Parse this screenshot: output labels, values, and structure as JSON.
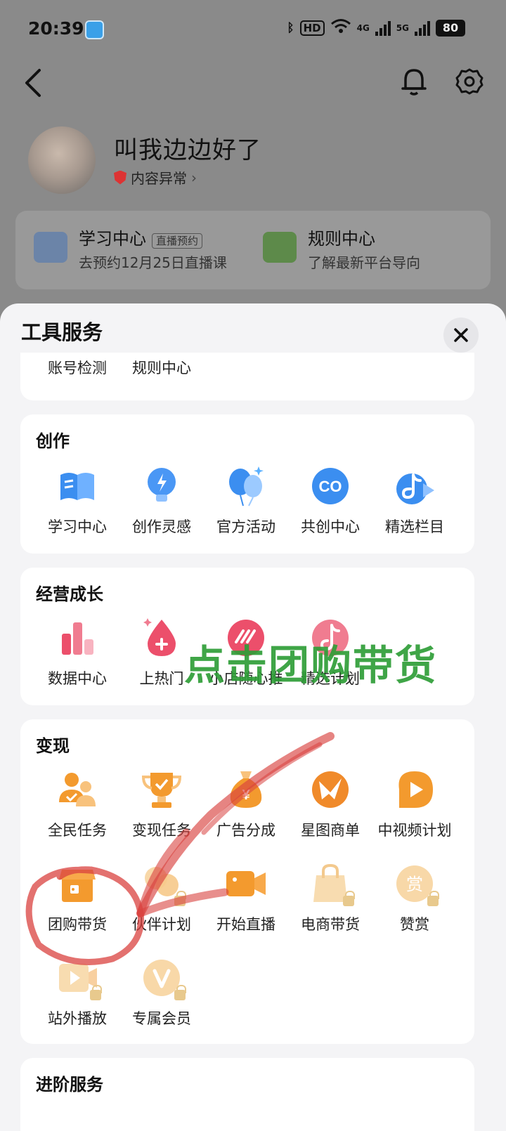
{
  "status_bar": {
    "time": "20:39",
    "hd_badge": "HD",
    "net_4g": "4G",
    "net_5g": "5G",
    "battery": "80"
  },
  "nav": {
    "back_icon": "back-arrow-icon",
    "bell_icon": "bell-icon",
    "settings_icon": "gear-icon"
  },
  "profile": {
    "name": "叫我边边好了",
    "status": "内容异常"
  },
  "background_cards": [
    {
      "title": "学习中心",
      "tag": "直播预约",
      "subtitle": "去预约12月25日直播课"
    },
    {
      "title": "规则中心",
      "subtitle": "了解最新平台导向"
    }
  ],
  "sheet": {
    "title": "工具服务",
    "top_card": {
      "items": [
        "账号检测",
        "规则中心"
      ]
    },
    "sections": [
      {
        "title": "创作",
        "items": [
          {
            "label": "学习中心",
            "icon": "book-icon"
          },
          {
            "label": "创作灵感",
            "icon": "lightbulb-icon"
          },
          {
            "label": "官方活动",
            "icon": "balloon-icon"
          },
          {
            "label": "共创中心",
            "icon": "co-icon"
          },
          {
            "label": "精选栏目",
            "icon": "music-note-icon"
          }
        ]
      },
      {
        "title": "经营成长",
        "items": [
          {
            "label": "数据中心",
            "icon": "bar-chart-icon"
          },
          {
            "label": "上热门",
            "icon": "flame-drop-icon"
          },
          {
            "label": "小店随心推",
            "icon": "boost-icon"
          },
          {
            "label": "精选计划",
            "icon": "tiktok-icon"
          }
        ]
      },
      {
        "title": "变现",
        "items": [
          {
            "label": "全民任务",
            "icon": "people-icon"
          },
          {
            "label": "变现任务",
            "icon": "trophy-icon"
          },
          {
            "label": "广告分成",
            "icon": "money-bag-icon"
          },
          {
            "label": "星图商单",
            "icon": "star-map-icon"
          },
          {
            "label": "中视频计划",
            "icon": "play-icon"
          },
          {
            "label": "团购带货",
            "icon": "shop-icon"
          },
          {
            "label": "伙伴计划",
            "icon": "partner-icon"
          },
          {
            "label": "开始直播",
            "icon": "camera-icon"
          },
          {
            "label": "电商带货",
            "icon": "shopping-bag-icon"
          },
          {
            "label": "赞赏",
            "icon": "reward-icon"
          },
          {
            "label": "站外播放",
            "icon": "external-play-icon"
          },
          {
            "label": "专属会员",
            "icon": "vip-icon"
          }
        ]
      },
      {
        "title": "进阶服务",
        "items": []
      }
    ]
  },
  "annotation": {
    "text": "点击团购带货"
  },
  "colors": {
    "accent_orange": "#f39a2e",
    "blue": "#3b8ef0",
    "pink": "#ec4f6b",
    "annotation_green": "#2f9e38",
    "annotation_red": "#d9423f"
  }
}
